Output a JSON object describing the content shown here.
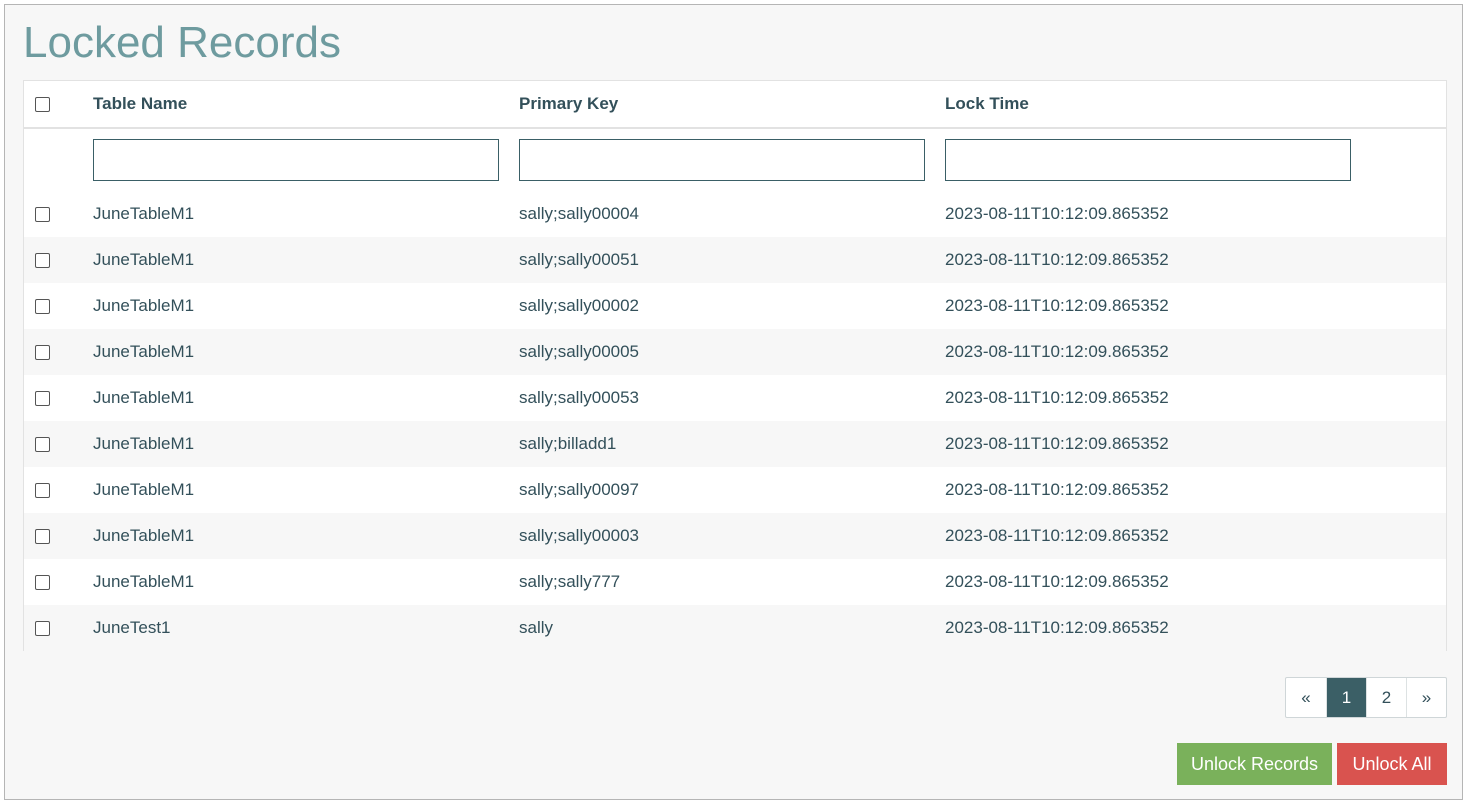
{
  "page": {
    "title": "Locked Records"
  },
  "table": {
    "columns": [
      "Table Name",
      "Primary Key",
      "Lock Time"
    ],
    "filters": [
      {
        "value": "",
        "placeholder": ""
      },
      {
        "value": "",
        "placeholder": ""
      },
      {
        "value": "",
        "placeholder": ""
      }
    ],
    "rows": [
      {
        "table_name": "JuneTableM1",
        "primary_key": "sally;sally00004",
        "lock_time": "2023-08-11T10:12:09.865352"
      },
      {
        "table_name": "JuneTableM1",
        "primary_key": "sally;sally00051",
        "lock_time": "2023-08-11T10:12:09.865352"
      },
      {
        "table_name": "JuneTableM1",
        "primary_key": "sally;sally00002",
        "lock_time": "2023-08-11T10:12:09.865352"
      },
      {
        "table_name": "JuneTableM1",
        "primary_key": "sally;sally00005",
        "lock_time": "2023-08-11T10:12:09.865352"
      },
      {
        "table_name": "JuneTableM1",
        "primary_key": "sally;sally00053",
        "lock_time": "2023-08-11T10:12:09.865352"
      },
      {
        "table_name": "JuneTableM1",
        "primary_key": "sally;billadd1",
        "lock_time": "2023-08-11T10:12:09.865352"
      },
      {
        "table_name": "JuneTableM1",
        "primary_key": "sally;sally00097",
        "lock_time": "2023-08-11T10:12:09.865352"
      },
      {
        "table_name": "JuneTableM1",
        "primary_key": "sally;sally00003",
        "lock_time": "2023-08-11T10:12:09.865352"
      },
      {
        "table_name": "JuneTableM1",
        "primary_key": "sally;sally777",
        "lock_time": "2023-08-11T10:12:09.865352"
      },
      {
        "table_name": "JuneTest1",
        "primary_key": "sally",
        "lock_time": "2023-08-11T10:12:09.865352"
      }
    ]
  },
  "pagination": {
    "prev": "«",
    "pages": [
      "1",
      "2"
    ],
    "next": "»",
    "current": "1"
  },
  "actions": {
    "unlock_records": "Unlock Records",
    "unlock_all": "Unlock All"
  },
  "colors": {
    "title": "#6e9b9f",
    "text": "#33505a",
    "active_page": "#3b5f66",
    "unlock_button": "#7ab15b",
    "unlock_all_button": "#d9534f"
  }
}
